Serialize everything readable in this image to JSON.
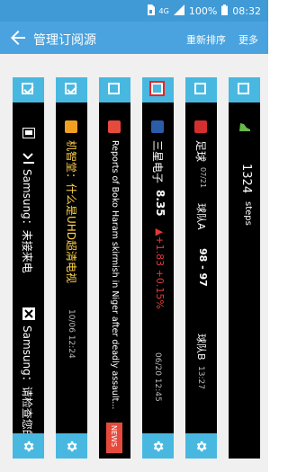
{
  "status": {
    "network": "4G",
    "battery": "100%",
    "time": "08:32"
  },
  "appbar": {
    "title": "管理订阅源",
    "sort_label": "重新排序",
    "more_label": "更多"
  },
  "cards": [
    {
      "checked": true,
      "rows": [
        {
          "icon": "monitor-icon",
          "text": ""
        },
        {
          "icon": "missed-call-icon",
          "text": "Samsung：未接来电"
        },
        {
          "icon": "close-box-icon",
          "text": "Samsung：请检查您的印"
        }
      ]
    },
    {
      "checked": true,
      "app": "机智堂：什么是UHD超清电视",
      "time": "10/06 12:24"
    },
    {
      "checked": false,
      "headline": "Reports of Boko Haram skirmish in Niger after deadly assault...",
      "tag": "NEWS"
    },
    {
      "checked": false,
      "selected": true,
      "name": "三星电子",
      "price": "8.35",
      "change": "▲+1.83 +0.15%",
      "time": "06/20 12:45"
    },
    {
      "checked": false,
      "league": "足球",
      "date": "07/21",
      "teamA": "球队A",
      "score": "98 - 97",
      "teamB": "球队B",
      "time": "13:27"
    },
    {
      "checked": false,
      "steps": "1324",
      "steps_unit": "steps"
    }
  ],
  "colors": {
    "statusbar": "#3f9ad6",
    "appbar": "#4aa3df",
    "card_accent": "#48b8e1",
    "up": "#e53935"
  }
}
